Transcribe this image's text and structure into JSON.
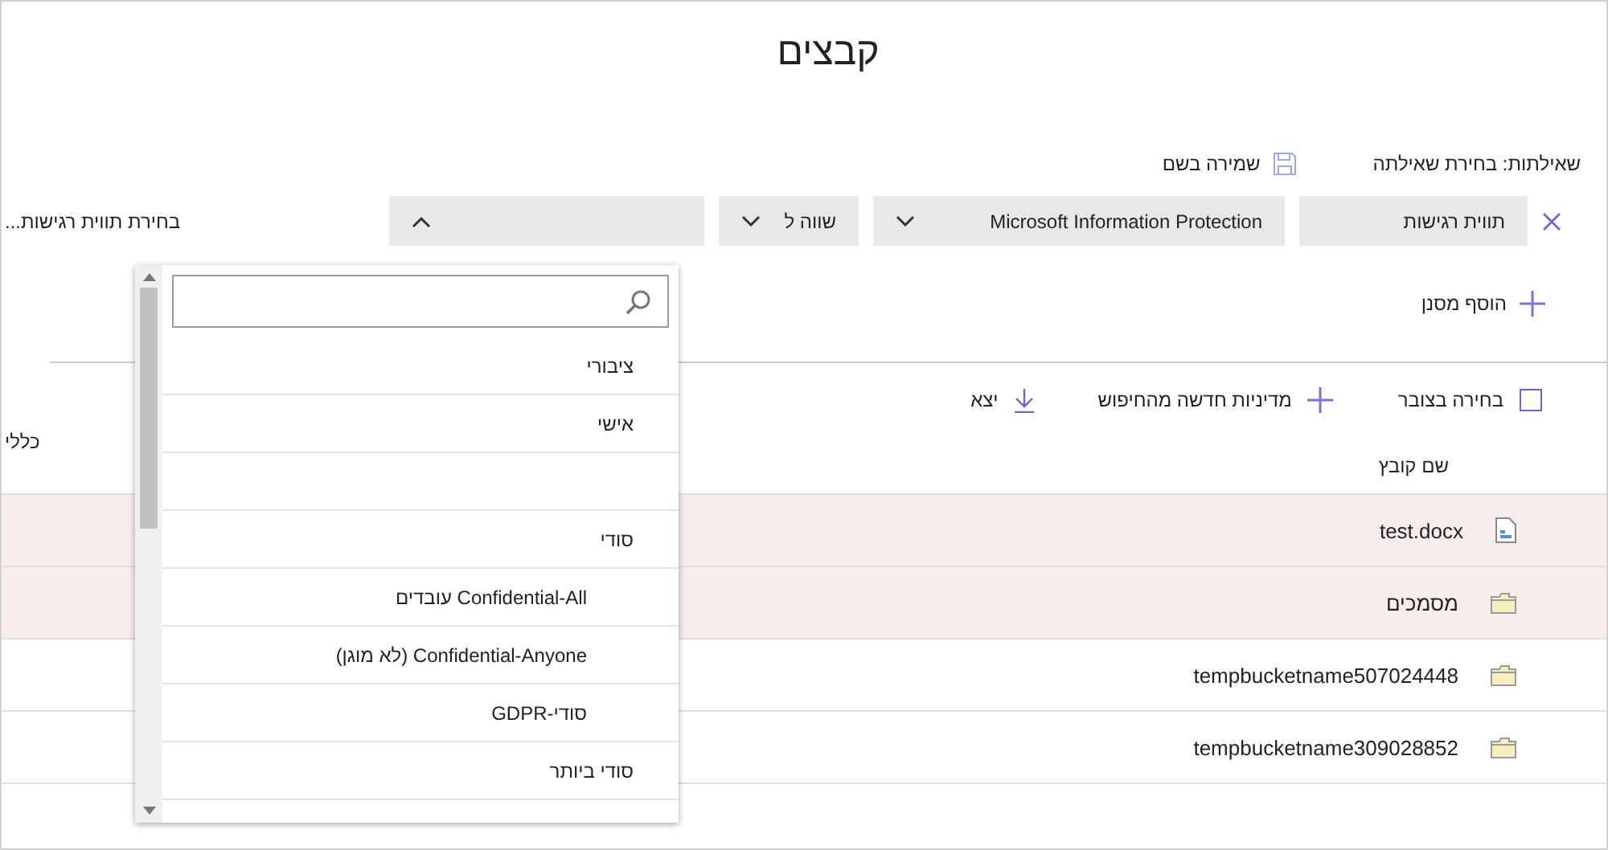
{
  "title": "קבצים",
  "query": {
    "label": "שאילתות: בחירת שאילתה",
    "save_as": "שמירה בשם"
  },
  "filter": {
    "field": "תווית רגישות",
    "source": "Microsoft Information Protection",
    "operator": "שווה ל",
    "value_expanded": true,
    "hint": "בחירת תווית רגישות..."
  },
  "add_filter": "הוסף מסנן",
  "dropdown": {
    "items": [
      {
        "kind": "option",
        "label": "ציבורי"
      },
      {
        "kind": "option",
        "label": "אישי"
      },
      {
        "kind": "blank"
      },
      {
        "kind": "option",
        "label": "סודי",
        "children": [
          {
            "kind": "option",
            "label": "Confidential-All עובדים"
          },
          {
            "kind": "option",
            "label": "Confidential-Anyone (לא מוגן)"
          },
          {
            "kind": "option",
            "label": "סודי-GDPR"
          }
        ]
      },
      {
        "kind": "option",
        "label": "סודי ביותר"
      }
    ]
  },
  "toolbar": {
    "select_all": {
      "label": "בחירה בצובר",
      "checked": false
    },
    "new_policy": "מדיניות חדשה מהחיפוש",
    "export": "יצא"
  },
  "table": {
    "columns": [
      "שם קובץ",
      "כללי"
    ],
    "rows": [
      {
        "kind": "document",
        "name": "test.docx",
        "highlighted": true
      },
      {
        "kind": "folder",
        "name": "מסמכים",
        "highlighted": true
      },
      {
        "kind": "folder",
        "name": "tempbucketname507024448",
        "highlighted": false
      },
      {
        "kind": "folder",
        "name": "tempbucketname309028852",
        "highlighted": false
      }
    ]
  }
}
